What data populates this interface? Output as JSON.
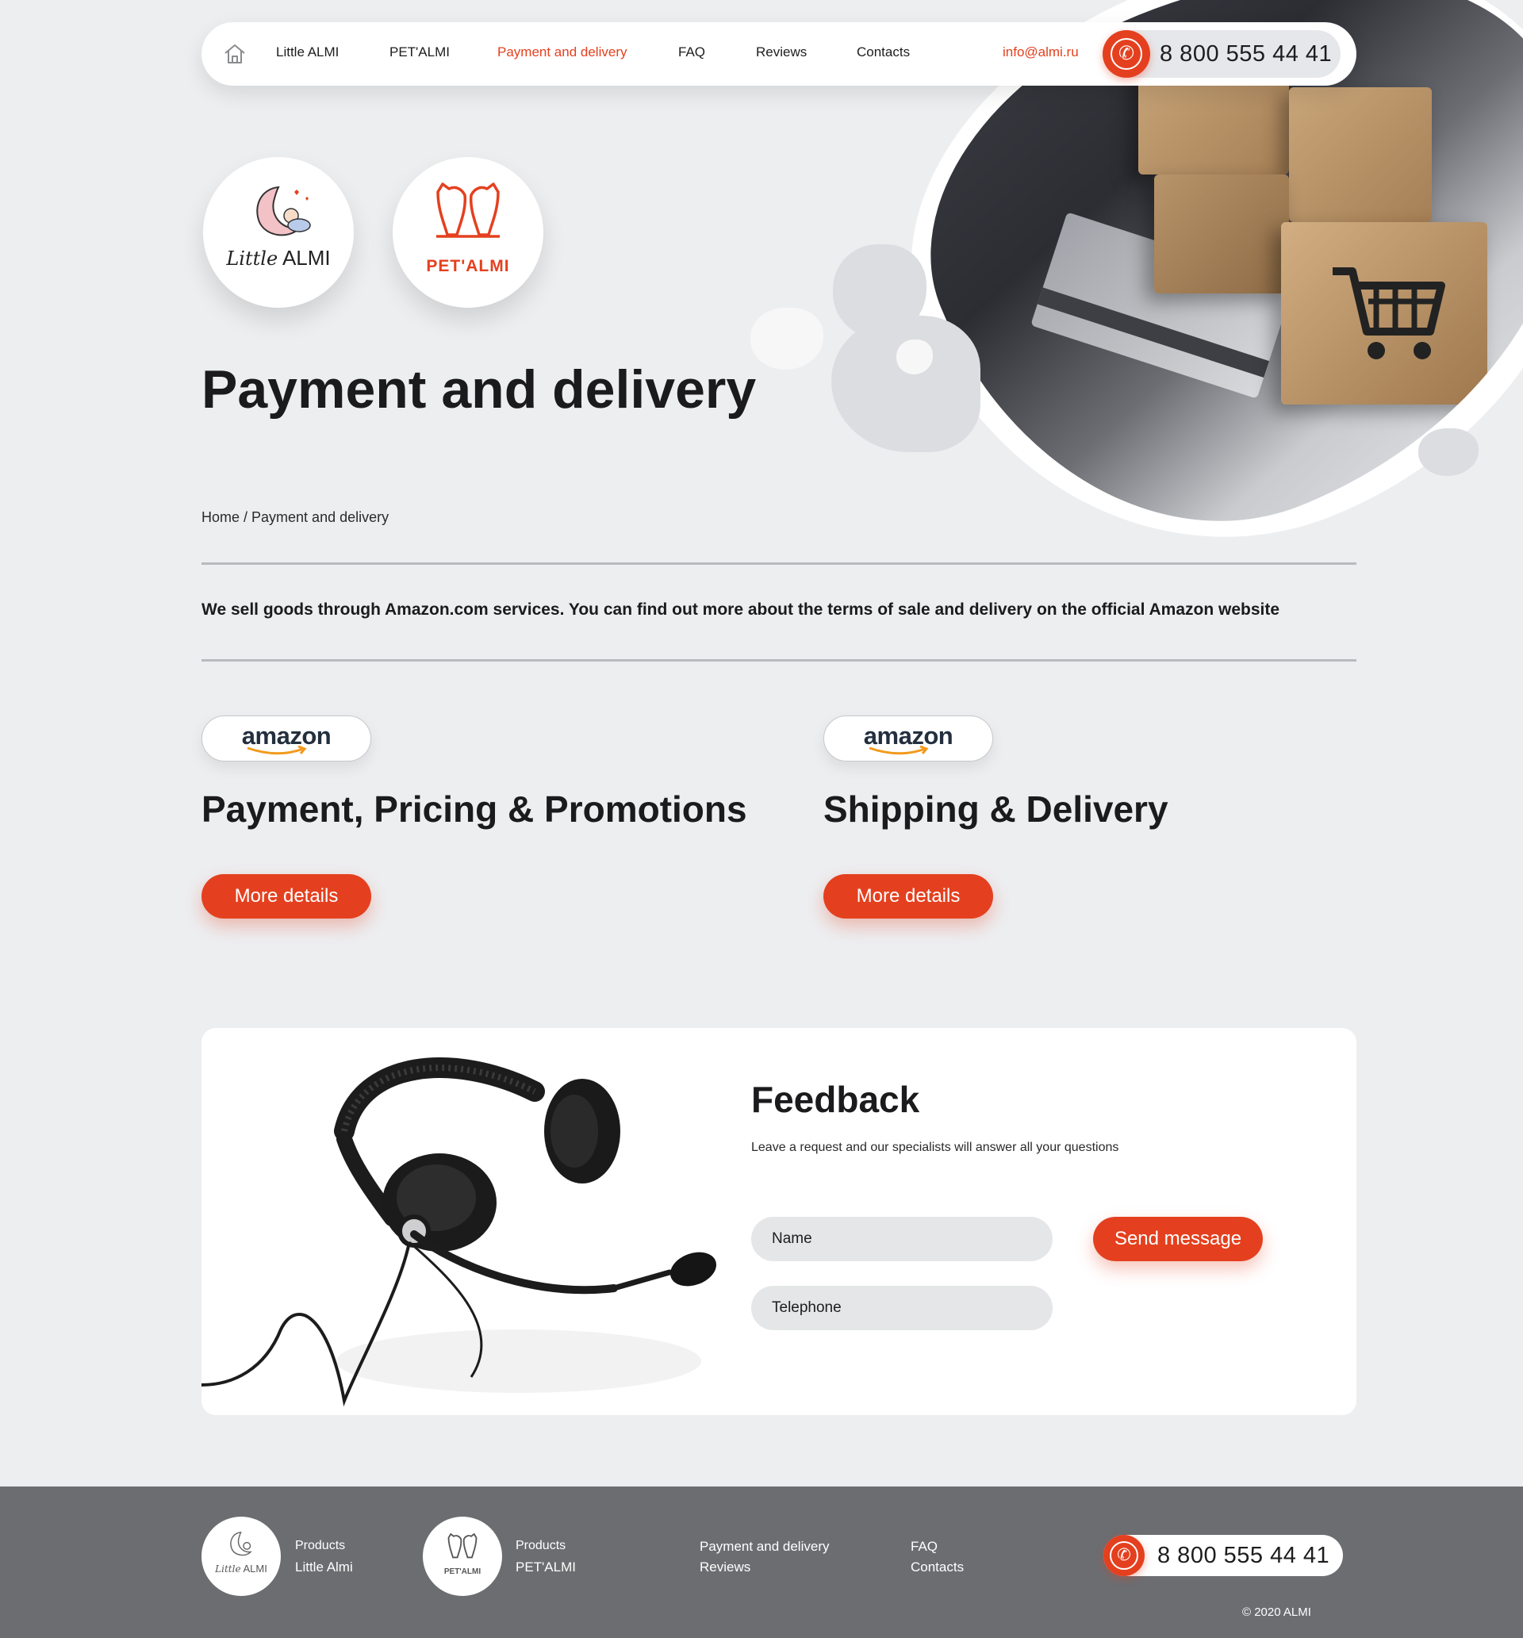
{
  "nav": {
    "items": [
      {
        "label": "Little ALMI"
      },
      {
        "label": "PET'ALMI"
      },
      {
        "label": "Payment and delivery"
      },
      {
        "label": "FAQ"
      },
      {
        "label": "Reviews"
      },
      {
        "label": "Contacts"
      }
    ],
    "active_index": 2,
    "email": "info@almi.ru",
    "phone": "8 800 555 44 41"
  },
  "logos": {
    "little_almi": {
      "script": "Little",
      "word": "ALMI"
    },
    "petalmi": {
      "word": "PET'ALMI"
    }
  },
  "page": {
    "title": "Payment and delivery",
    "breadcrumb": "Home / Payment and delivery",
    "intro": "We sell goods through Amazon.com services. You can find out more about the terms of sale and delivery on the official Amazon website"
  },
  "sections": [
    {
      "badge": "amazon",
      "title": "Payment, Pricing & Promotions",
      "button": "More details"
    },
    {
      "badge": "amazon",
      "title": "Shipping & Delivery",
      "button": "More details"
    }
  ],
  "feedback": {
    "title": "Feedback",
    "subtitle": "Leave a request and our specialists will answer all your questions",
    "name_placeholder": "Name",
    "phone_placeholder": "Telephone",
    "submit": "Send message"
  },
  "footer": {
    "brand1": {
      "line1": "Products",
      "line2": "Little Almi",
      "logo_script": "Little",
      "logo_word": "ALMI"
    },
    "brand2": {
      "line1": "Products",
      "line2": "PET'ALMI",
      "logo_word": "PET'ALMI"
    },
    "links_col1": [
      "Payment and delivery",
      "Reviews"
    ],
    "links_col2": [
      "FAQ",
      "Contacts"
    ],
    "phone": "8 800 555 44 41",
    "copyright": "© 2020 ALMI"
  },
  "colors": {
    "accent": "#e4401f",
    "footer_bg": "#6c6d71",
    "page_bg": "#edeef0"
  }
}
